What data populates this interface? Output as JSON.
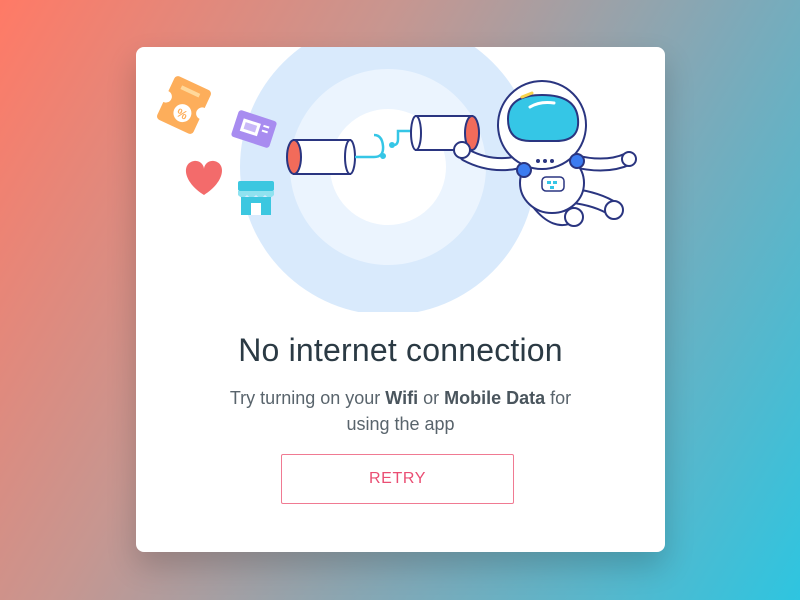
{
  "dialog": {
    "title": "No internet connection",
    "message_parts": [
      "Try turning on your ",
      "Wifi",
      " or ",
      "Mobile Data",
      " for using the app"
    ],
    "retry_label": "RETRY"
  },
  "illustration": {
    "icons": [
      "ticket-icon",
      "coupon-icon",
      "heart-icon",
      "store-icon",
      "tin-can-telephone-icon",
      "astronaut-icon"
    ],
    "colors": {
      "ring_outer": "#d6e8fb",
      "ring_inner": "#eaf3fd",
      "outline": "#2a3580",
      "visor": "#35c6e6",
      "can_rim": "#f26b5a",
      "heart": "#f36b6b",
      "ticket": "#fdae5b",
      "coupon": "#a88cf0",
      "store": "#3cc7e0",
      "accent": "#ea4e73"
    }
  }
}
